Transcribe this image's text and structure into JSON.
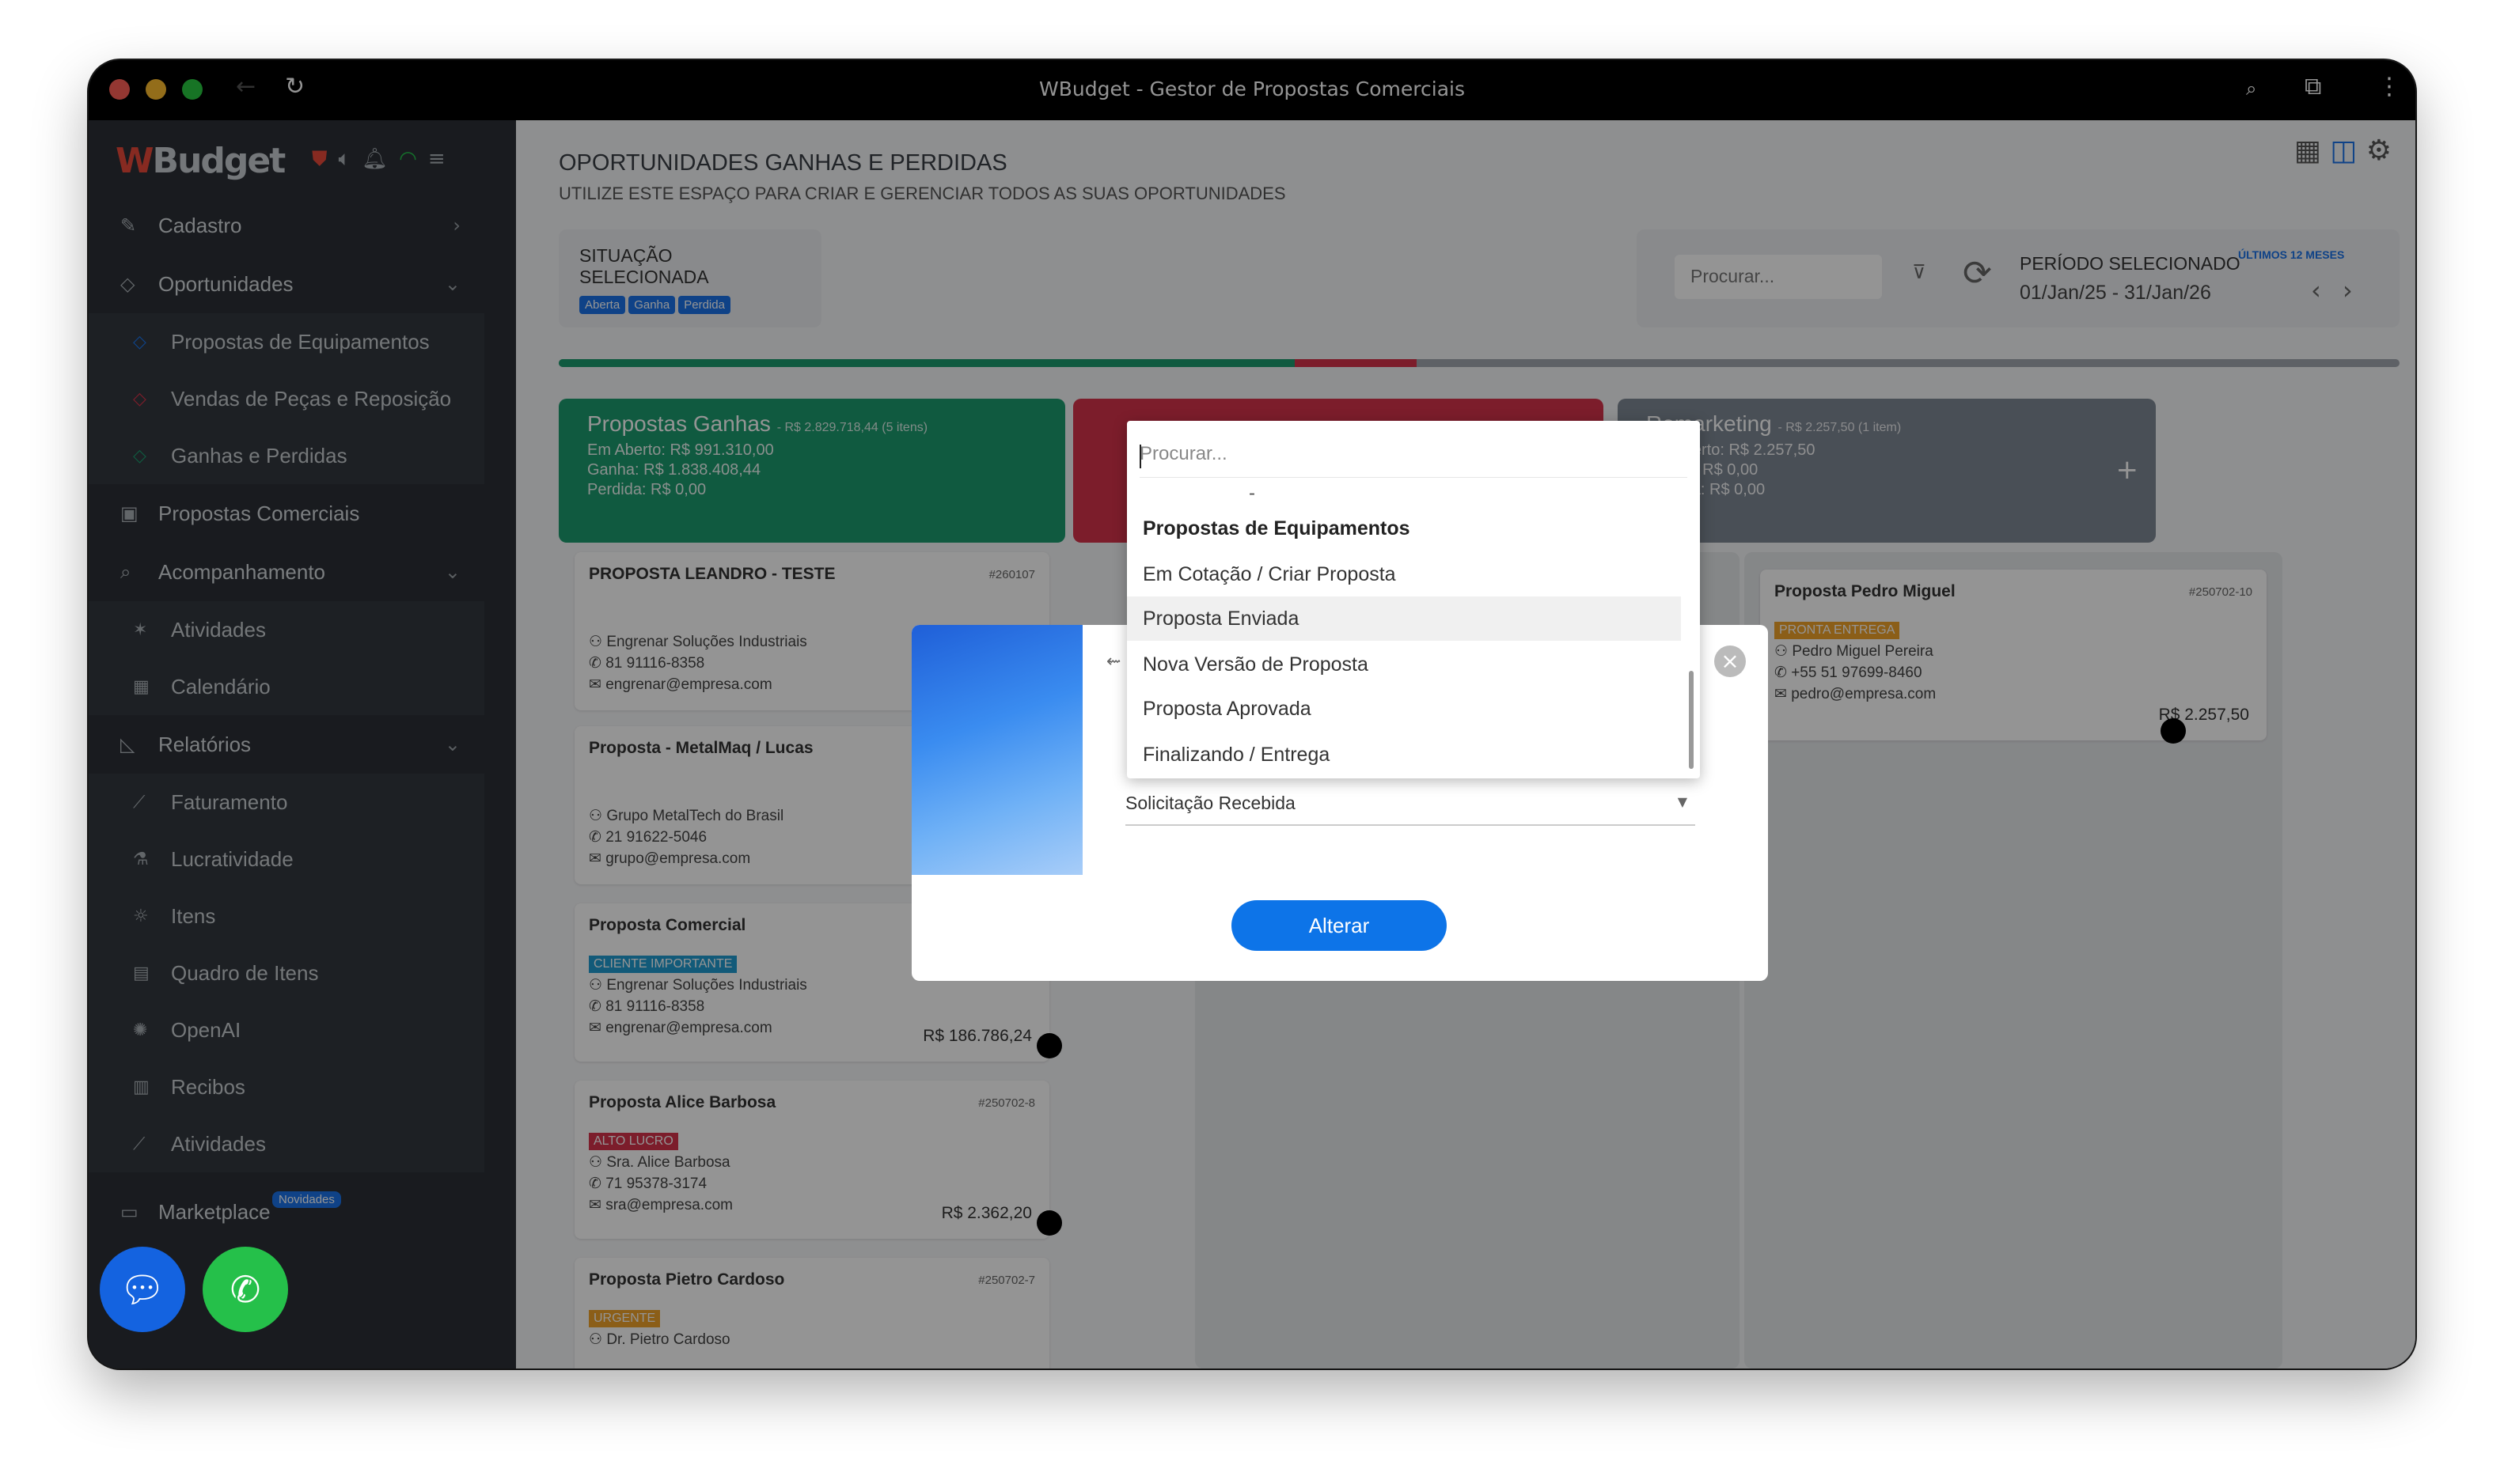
{
  "window": {
    "title": "WBudget - Gestor de Propostas Comerciais"
  },
  "sidebar": {
    "logo": "Budget",
    "logo_mark": "W",
    "menu": [
      {
        "label": "Cadastro",
        "icon": "edit-icon"
      },
      {
        "label": "Oportunidades",
        "icon": "tag-icon"
      },
      {
        "label": "Propostas de Equipamentos",
        "icon": "tag-blue-icon"
      },
      {
        "label": "Vendas de Peças e Reposição",
        "icon": "tag-red-icon"
      },
      {
        "label": "Ganhas e Perdidas",
        "icon": "tag-green-icon"
      },
      {
        "label": "Propostas Comerciais",
        "icon": "briefcase-icon"
      },
      {
        "label": "Acompanhamento",
        "icon": "document-search-icon"
      },
      {
        "label": "Atividades",
        "icon": "run-icon"
      },
      {
        "label": "Calendário",
        "icon": "calendar-icon"
      },
      {
        "label": "Relatórios",
        "icon": "chart-area-icon"
      },
      {
        "label": "Faturamento",
        "icon": "chart-line-icon"
      },
      {
        "label": "Lucratividade",
        "icon": "flask-icon"
      },
      {
        "label": "Itens",
        "icon": "lightbulb-icon"
      },
      {
        "label": "Quadro de Itens",
        "icon": "clipboard-icon"
      },
      {
        "label": "OpenAI",
        "icon": "openai-icon"
      },
      {
        "label": "Recibos",
        "icon": "receipt-icon"
      },
      {
        "label": "Atividades",
        "icon": "chart-line-icon"
      }
    ],
    "marketplace": "Marketplace",
    "novidades": "Novidades"
  },
  "main": {
    "title": "OPORTUNIDADES GANHAS E PERDIDAS",
    "subtitle": "UTILIZE ESTE ESPAÇO PARA CRIAR E GERENCIAR TODOS AS SUAS OPORTUNIDADES",
    "situacao": {
      "title": "SITUAÇÃO SELECIONADA",
      "pills": [
        "Aberta",
        "Ganha",
        "Perdida"
      ]
    },
    "periodo": {
      "search_placeholder": "Procurar...",
      "title": "PERÍODO SELECIONADO",
      "badge": "ÚLTIMOS 12 MESES",
      "value": "01/Jan/25 - 31/Jan/26"
    },
    "columns": [
      {
        "title": "Propostas Ganhas",
        "summary": "- R$ 2.829.718,44 (5 itens)",
        "aberto": "Em Aberto: R$ 991.310,00",
        "ganha": "Ganha: R$ 1.838.408,44",
        "perdida": "Perdida: R$ 0,00",
        "color": "#1c9b6e"
      },
      {
        "title": "Remarketing",
        "summary": "- R$ 2.257,50 (1 item)",
        "aberto": "Em Aberto: R$ 2.257,50",
        "ganha": "Ganha: R$ 0,00",
        "perdida": "Perdida: R$ 0,00",
        "color": "#7f8994"
      }
    ],
    "cards": [
      {
        "title": "PROPOSTA LEANDRO - TESTE",
        "id": "#260107",
        "company": "Engrenar Soluções Industriais",
        "phone": "81 91116-8358",
        "email": "engrenar@empresa.com"
      },
      {
        "title": "Proposta - MetalMaq / Lucas",
        "company": "Grupo MetalTech do Brasil",
        "phone": "21 91622-5046",
        "email": "grupo@empresa.com"
      },
      {
        "title": "Proposta Comercial",
        "tag": "CLIENTE IMPORTANTE",
        "tag_color": "#1f9bd1",
        "company": "Engrenar Soluções Industriais",
        "phone": "81 91116-8358",
        "email": "engrenar@empresa.com",
        "price": "R$ 186.786,24"
      },
      {
        "title": "Proposta Alice Barbosa",
        "id": "#250702-8",
        "tag": "ALTO LUCRO",
        "tag_color": "#d6334a",
        "company": "Sra. Alice Barbosa",
        "phone": "71 95378-3174",
        "email": "sra@empresa.com",
        "price": "R$ 2.362,20"
      },
      {
        "title": "Proposta Pietro Cardoso",
        "id": "#250702-7",
        "tag": "URGENTE",
        "tag_color": "#f0a32a",
        "company": "Dr. Pietro Cardoso"
      },
      {
        "title": "Proposta Pedro Miguel",
        "id": "#250702-10",
        "tag": "PRONTA ENTREGA",
        "tag_color": "#f0a32a",
        "company": "Pedro Miguel Pereira",
        "phone": "+55 51 97699-8460",
        "email": "pedro@empresa.com",
        "price": "R$ 2.257,50"
      }
    ]
  },
  "modal": {
    "select_value": "Solicitação Recebida",
    "button": "Alterar"
  },
  "dropdown": {
    "search_placeholder": "Procurar...",
    "dash": "-",
    "group": "Propostas de Equipamentos",
    "items": [
      "Em Cotação / Criar Proposta",
      "Proposta Enviada",
      "Nova Versão de Proposta",
      "Proposta Aprovada",
      "Finalizando / Entrega"
    ],
    "highlighted_index": 1
  },
  "progress": {
    "won_fraction": 0.4,
    "lost_fraction": 0.066
  },
  "colors": {
    "green": "#1c9b6e",
    "red": "#d6334a",
    "blue": "#0d74e8",
    "whatsapp": "#25c04a"
  }
}
